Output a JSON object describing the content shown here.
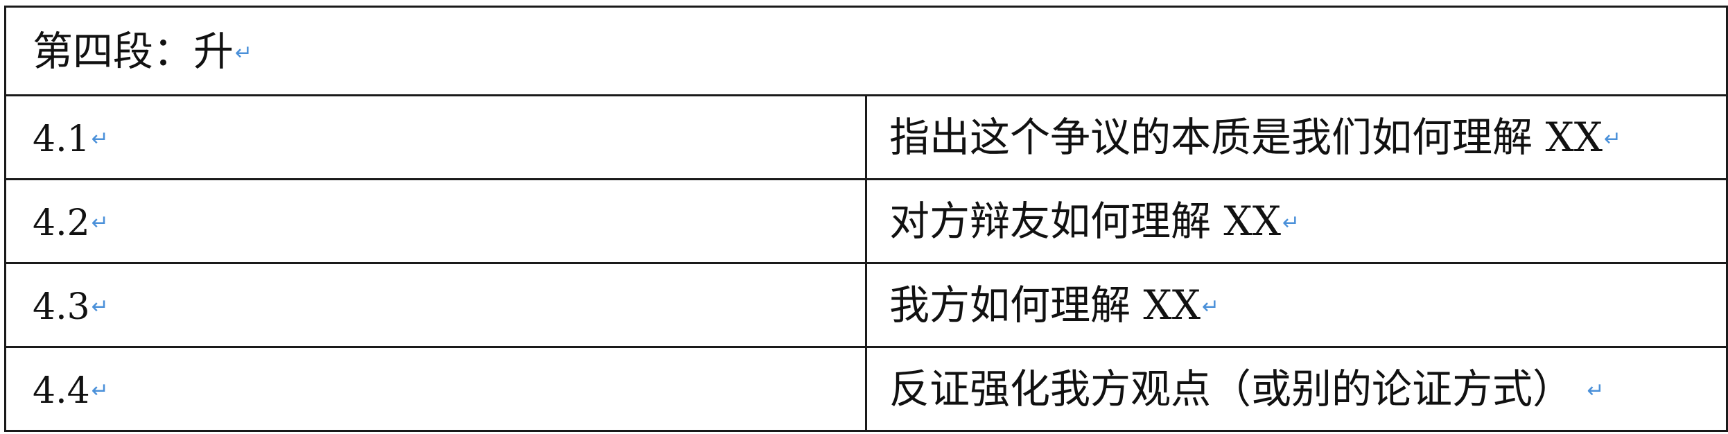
{
  "table": {
    "header": "第四段：升",
    "rows": [
      {
        "num": "4.1",
        "text": "指出这个争议的本质是我们如何理解 XX"
      },
      {
        "num": "4.2",
        "text": "对方辩友如何理解 XX"
      },
      {
        "num": "4.3",
        "text": "我方如何理解 XX"
      },
      {
        "num": "4.4",
        "text": "反证强化我方观点（或别的论证方式）"
      }
    ]
  },
  "icons": {
    "paragraph_mark": "return-arrow-icon",
    "paragraph_mark_glyph": "↵",
    "paragraph_mark_color": "#4a90d9"
  }
}
